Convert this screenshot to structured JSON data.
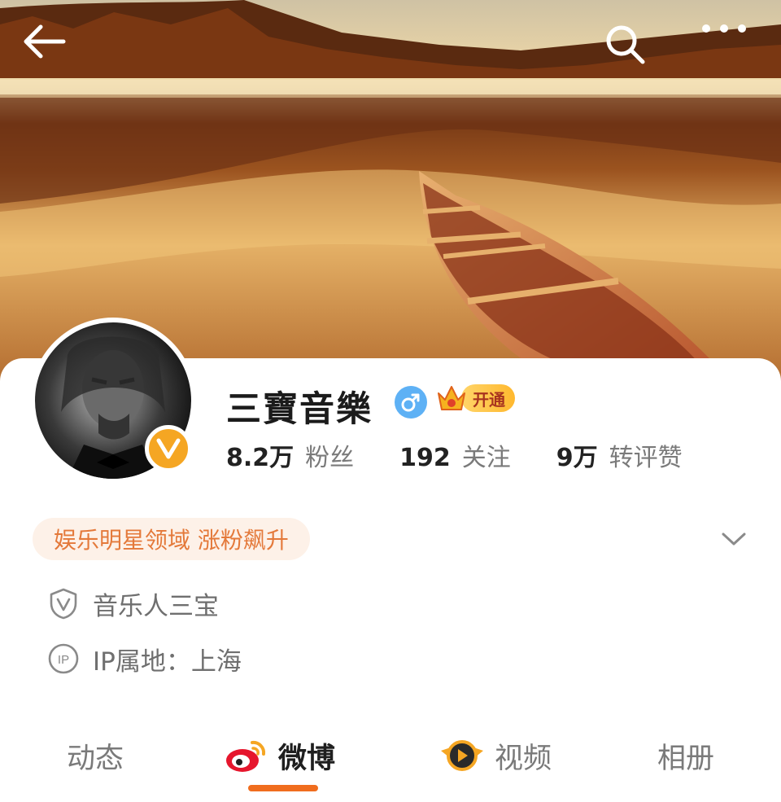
{
  "header": {
    "back_icon": "arrow-left-icon",
    "search_icon": "search-icon",
    "more_icon": "more-dots-icon"
  },
  "profile": {
    "name": "三寶音樂",
    "gender_icon": "male-icon",
    "vip_label": "开通",
    "verified_badge_icon": "verified-v-icon",
    "stats": [
      {
        "value": "8.2万",
        "label": "粉丝"
      },
      {
        "value": "192",
        "label": "关注"
      },
      {
        "value": "9万",
        "label": "转评赞"
      }
    ]
  },
  "tag": {
    "label": "娱乐明星领域 涨粉飙升"
  },
  "info": {
    "verification": "音乐人三宝",
    "ip_location": "IP属地：上海"
  },
  "tabs": [
    {
      "label": "动态"
    },
    {
      "label": "微博",
      "icon": "weibo-logo-icon",
      "active": true
    },
    {
      "label": "视频",
      "icon": "video-play-icon"
    },
    {
      "label": "相册"
    }
  ],
  "colors": {
    "accent": "#f06d1e",
    "tag_text": "#e4793a",
    "tag_bg": "#fdf1e8",
    "verified": "#f5a623",
    "gender": "#5eb1f5"
  }
}
